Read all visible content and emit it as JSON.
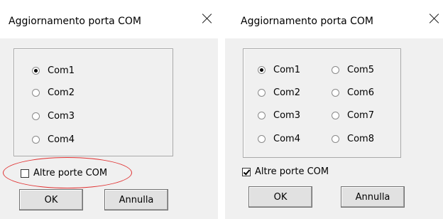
{
  "left_dialog": {
    "title": "Aggiornamento porta COM",
    "ports": [
      "Com1",
      "Com2",
      "Com3",
      "Com4"
    ],
    "selected_port": "Com1",
    "other_ports_label": "Altre porte COM",
    "other_ports_checked": false,
    "ok_label": "OK",
    "cancel_label": "Annulla"
  },
  "right_dialog": {
    "title": "Aggiornamento porta COM",
    "ports": [
      "Com1",
      "Com2",
      "Com3",
      "Com4",
      "Com5",
      "Com6",
      "Com7",
      "Com8"
    ],
    "selected_port": "Com1",
    "other_ports_label": "Altre porte COM",
    "other_ports_checked": true,
    "ok_label": "OK",
    "cancel_label": "Annulla"
  },
  "annotation_color": "#e03030",
  "icons": {
    "close": "close-icon"
  }
}
